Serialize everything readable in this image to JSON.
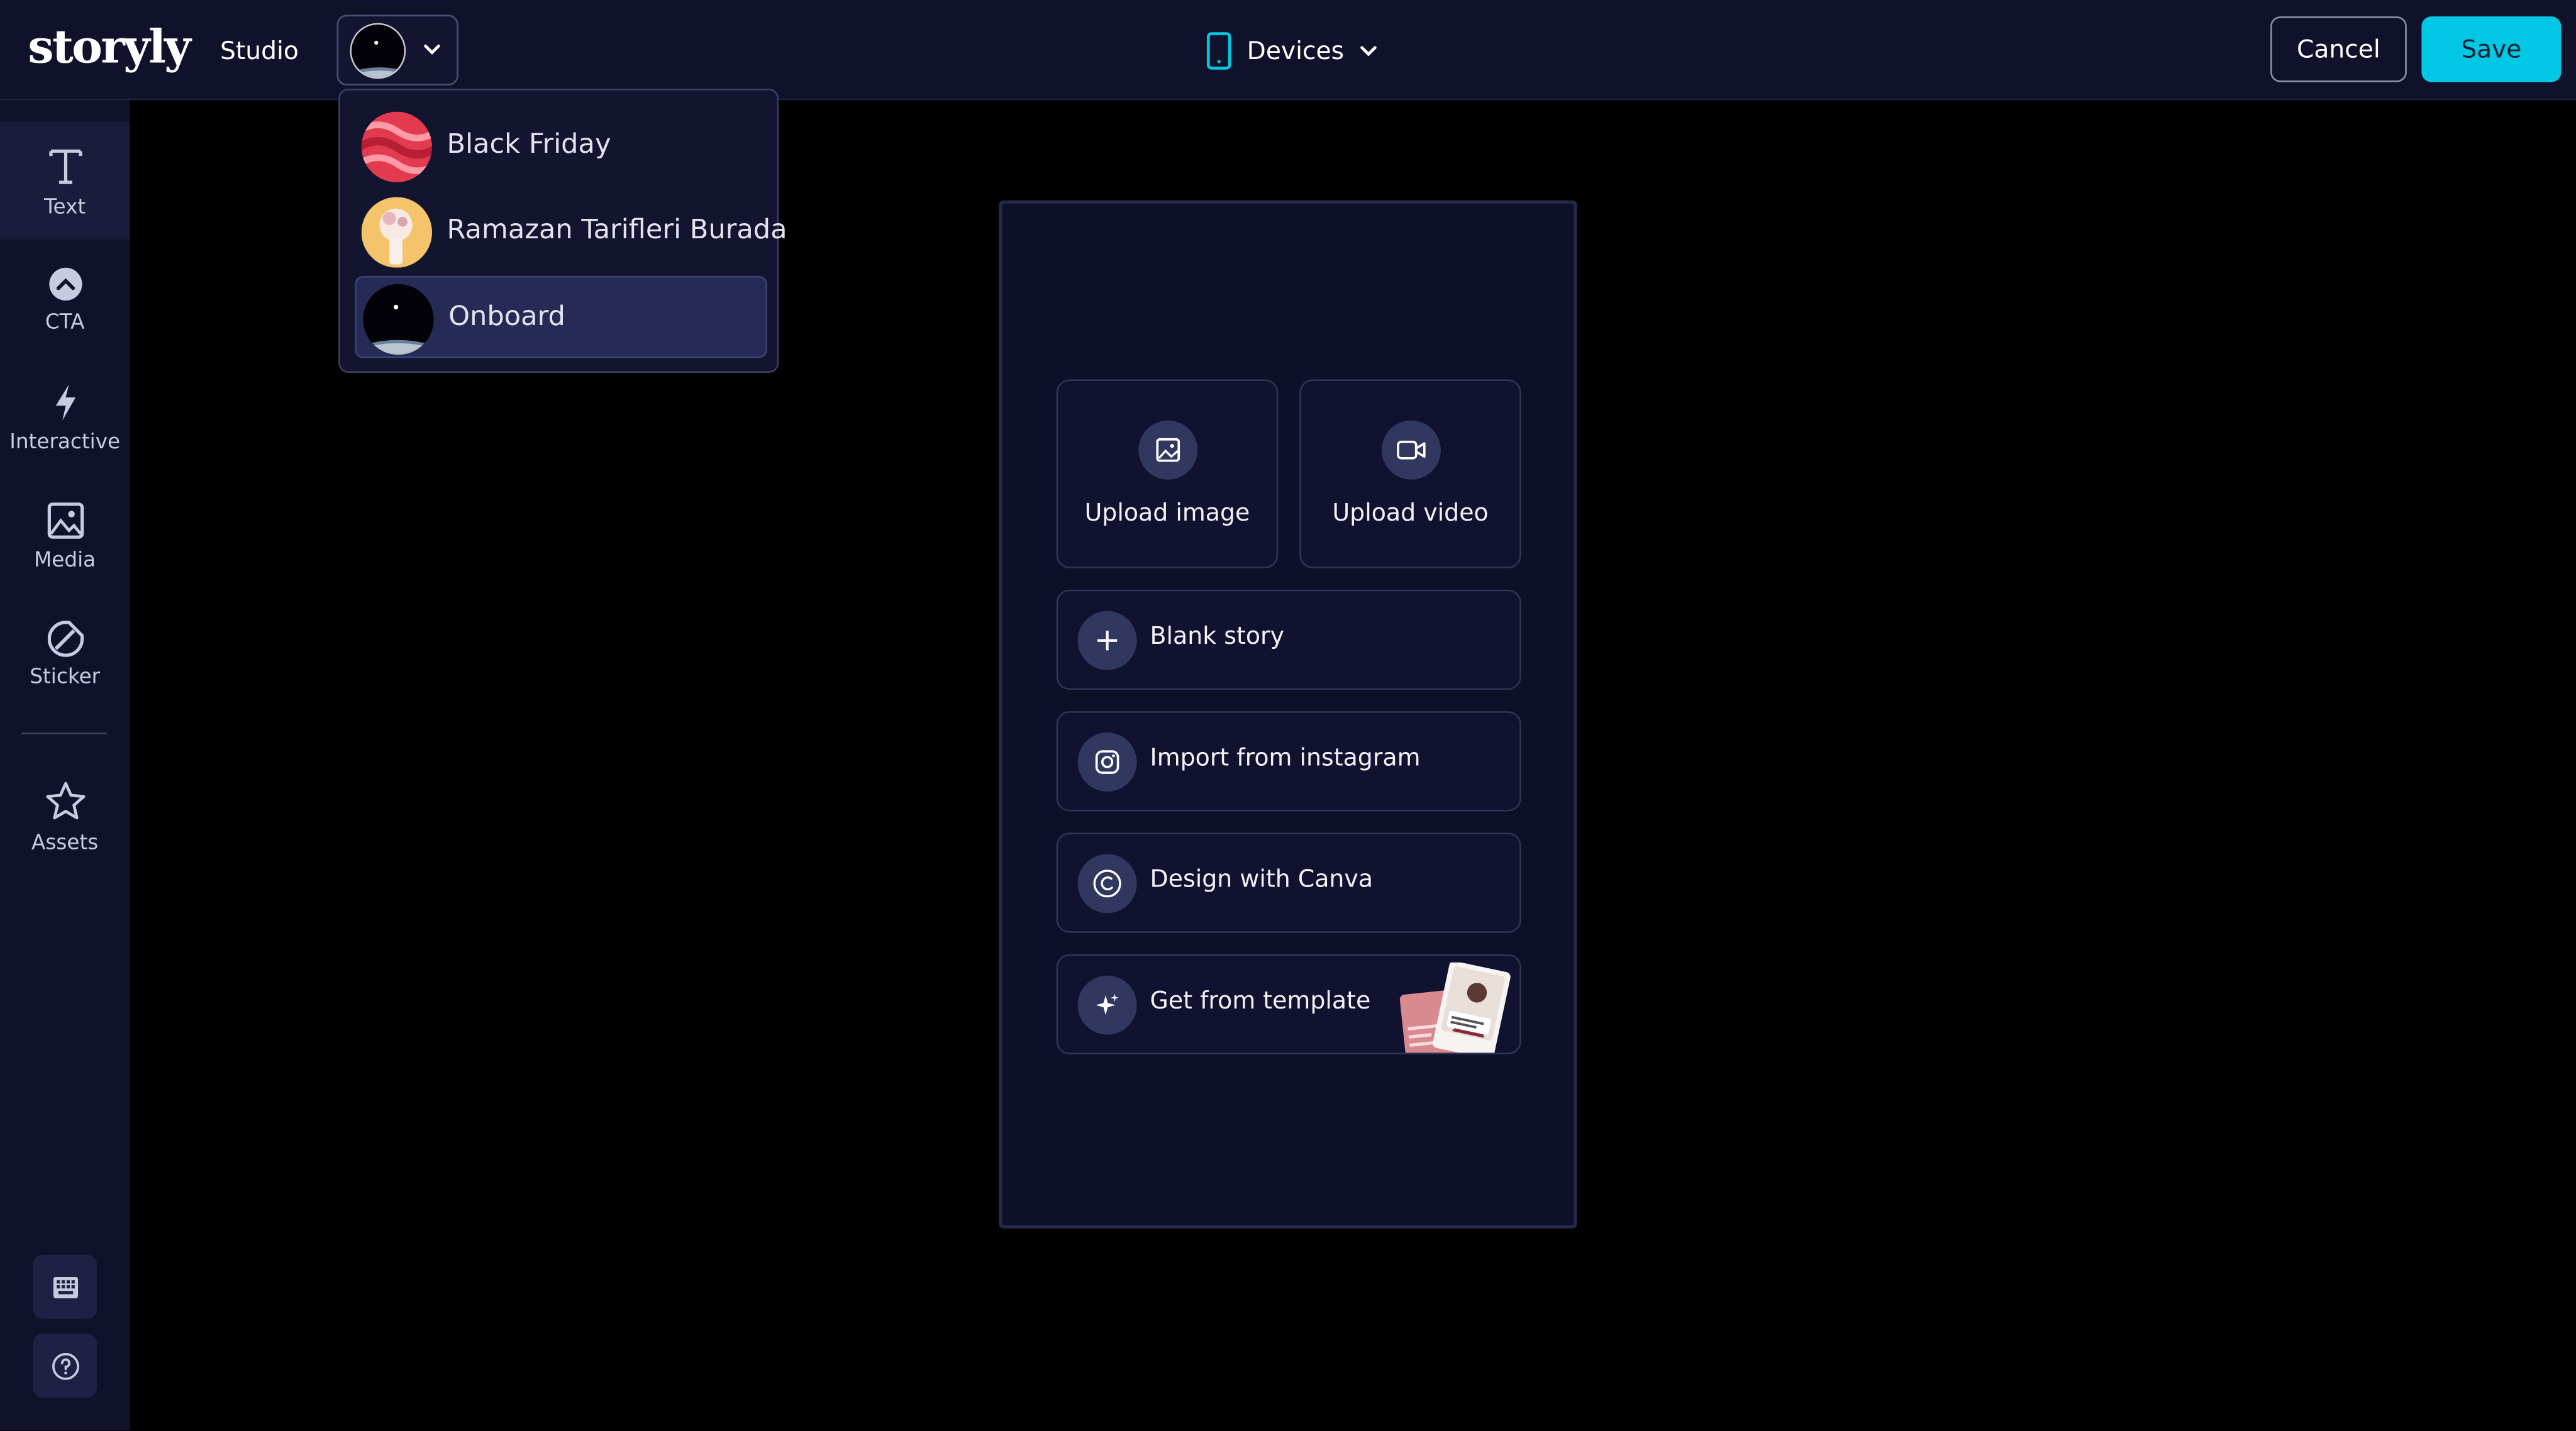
{
  "header": {
    "logo_text": "storyly",
    "studio_label": "Studio",
    "devices_label": "Devices",
    "cancel_label": "Cancel",
    "save_label": "Save"
  },
  "sidebar": {
    "items": [
      {
        "label": "Text",
        "icon": "text-icon"
      },
      {
        "label": "CTA",
        "icon": "cta-icon"
      },
      {
        "label": "Interactive",
        "icon": "lightning-icon"
      },
      {
        "label": "Media",
        "icon": "image-icon"
      },
      {
        "label": "Sticker",
        "icon": "sticker-icon"
      },
      {
        "label": "Assets",
        "icon": "star-icon"
      }
    ],
    "bottom_icons": [
      "keyboard-icon",
      "help-icon"
    ]
  },
  "story_dropdown": {
    "items": [
      {
        "name": "Black Friday",
        "selected": false
      },
      {
        "name": "Ramazan Tarifleri Burada",
        "selected": false
      },
      {
        "name": "Onboard",
        "selected": true
      }
    ]
  },
  "canvas": {
    "upload_image_label": "Upload image",
    "upload_video_label": "Upload video",
    "options": [
      {
        "label": "Blank story",
        "icon": "plus-icon"
      },
      {
        "label": "Import from instagram",
        "icon": "instagram-icon"
      },
      {
        "label": "Design with Canva",
        "icon": "canva-icon"
      },
      {
        "label": "Get from template",
        "icon": "sparkle-icon"
      }
    ]
  },
  "colors": {
    "accent": "#00c8e4",
    "background": "#000000",
    "panel": "#10122b",
    "selected_item": "#262a55"
  }
}
